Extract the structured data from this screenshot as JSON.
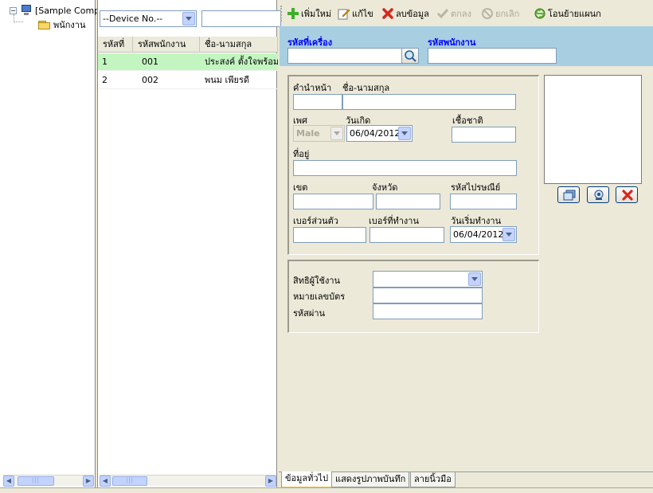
{
  "tree": {
    "root_label": "[Sample Comp",
    "child_label": "พนักงาน"
  },
  "list": {
    "device_combo": "--Device No.--",
    "columns": [
      "รหัสที่",
      "รหัสพนักงาน",
      "ชื่อ-นามสกุล"
    ],
    "rows": [
      {
        "no": "1",
        "emp_id": "001",
        "name": "ประสงค์ ตั้งใจพร้อม",
        "selected": true
      },
      {
        "no": "2",
        "emp_id": "002",
        "name": "พนม เพียรดี",
        "selected": false
      }
    ]
  },
  "toolbar": {
    "add": "เพิ่มใหม่",
    "edit": "แก้ไข",
    "delete": "ลบข้อมูล",
    "ok": "ตกลง",
    "cancel": "ยกเลิก",
    "transfer": "โอนย้ายแผนก"
  },
  "header": {
    "machine_id_label": "รหัสที่เครื่อง",
    "employee_id_label": "รหัสพนักงาน"
  },
  "form": {
    "prefix_label": "คำนำหน้า",
    "fullname_label": "ชื่อ-นามสกุล",
    "gender_label": "เพศ",
    "gender_value": "Male",
    "birthdate_label": "วันเกิด",
    "birthdate_value": "06/04/2012",
    "nationality_label": "เชื้อชาติ",
    "address_label": "ที่อยู่",
    "district_label": "เขต",
    "province_label": "จังหวัด",
    "postcode_label": "รหัสไปรษณีย์",
    "personal_phone_label": "เบอร์ส่วนตัว",
    "work_phone_label": "เบอร์ที่ทำงาน",
    "start_date_label": "วันเริ่มทำงาน",
    "start_date_value": "06/04/2012"
  },
  "access": {
    "user_rights_label": "สิทธิผู้ใช้งาน",
    "card_number_label": "หมายเลขบัตร",
    "password_label": "รหัสผ่าน"
  },
  "tabs": [
    "ข้อมูลทั่วไป",
    "แสดงรูปภาพบันทึก",
    "ลายนิ้วมือ"
  ],
  "colors": {
    "band": "#a7cfe1",
    "band_label": "#0000ff",
    "selected_row": "#c3f5c0"
  }
}
